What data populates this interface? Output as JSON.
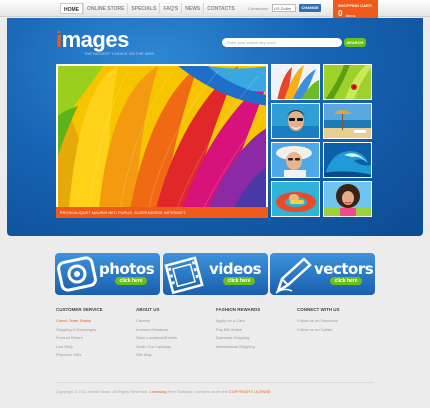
{
  "nav": {
    "items": [
      "HOME",
      "ONLINE STORE",
      "SPECIALS",
      "FAQ'S",
      "NEWS",
      "CONTACTS"
    ]
  },
  "currency": {
    "label": "Currencies:",
    "selected": "US Dollar",
    "change_label": "CHANGE"
  },
  "cart": {
    "title": "SHOPPING CART:",
    "count": "0",
    "items_label": "items"
  },
  "logo": {
    "first_letter": "i",
    "rest": "mages",
    "tagline": "THE BIGGEST CHOICE ON THE WEB"
  },
  "search": {
    "placeholder": "Enter your search key word",
    "button": "SEARCH"
  },
  "hero": {
    "caption": "PROIN ALIQUET MAURIS NEC PURUS. SUSPENDISSE IMPERDIET."
  },
  "features": [
    {
      "title": "photos",
      "button": "click here"
    },
    {
      "title": "videos",
      "button": "click here"
    },
    {
      "title": "vectors",
      "button": "click here"
    }
  ],
  "footer": {
    "columns": [
      {
        "title": "CUSTOMER SERVICE",
        "links": [
          "Check Order Status",
          "Shipping & Exchanges",
          "Product Return",
          "Live Help",
          "Premium Gifts"
        ]
      },
      {
        "title": "ABOUT US",
        "links": [
          "Careers",
          "Investor Relations",
          "Store Locations/Events",
          "Order Our Catalogs",
          "Site Map"
        ]
      },
      {
        "title": "FASHION REWARDS",
        "links": [
          "Apply for a Card",
          "Pay Bill Online",
          "Domestic Shipping",
          "International Shipping"
        ]
      },
      {
        "title": "CONNECT WITH US",
        "links": [
          "Follow us on Facebook",
          "Follow us on Twitter"
        ]
      }
    ],
    "copyright_prefix": "Copyright © 2011 Venue Ideas. All Rights Reserved.",
    "license_link": "Licensing",
    "copyright_middle": "Free Software Licenses under the",
    "terms_link": "COPYRIGHT LICENSE"
  },
  "colors": {
    "accent_orange": "#f05a1a",
    "hero_blue": "#1764b4",
    "button_green": "#6abf1b"
  }
}
